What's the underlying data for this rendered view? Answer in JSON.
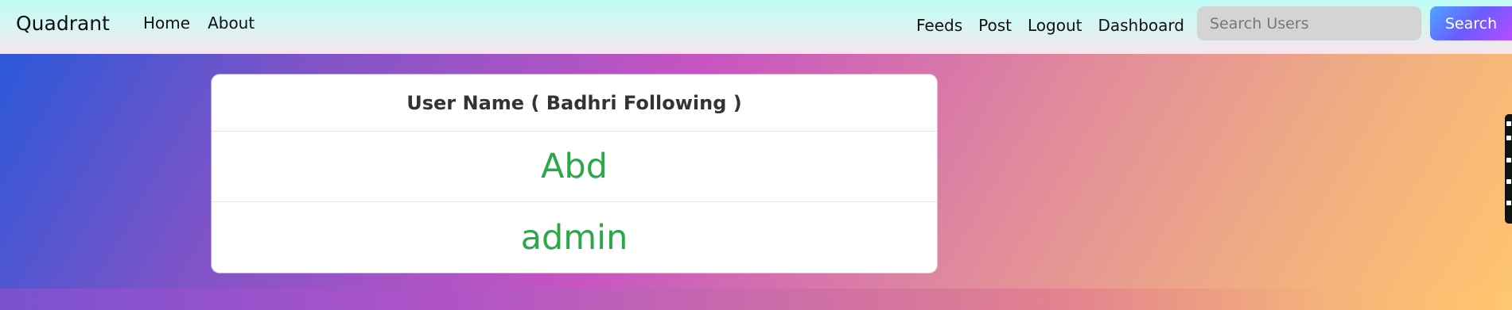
{
  "app": {
    "brand": "Quadrant"
  },
  "navbar": {
    "left_items": [
      "Home",
      "About"
    ],
    "right_items": [
      "Feeds",
      "Post",
      "Logout",
      "Dashboard"
    ],
    "search": {
      "placeholder": "Search Users",
      "button_label": "Search"
    }
  },
  "table": {
    "header": "User Name ( Badhri Following )",
    "rows": [
      "Abd",
      "admin"
    ]
  },
  "theme": {
    "accent_green": "#2aa84a",
    "search_button_blue": "#4ca7ff",
    "search_button_purple": "#b84cff"
  }
}
